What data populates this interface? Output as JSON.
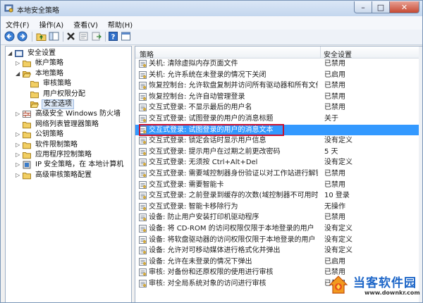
{
  "window": {
    "title": "本地安全策略"
  },
  "menu": [
    "文件(F)",
    "操作(A)",
    "查看(V)",
    "帮助(H)"
  ],
  "toolbar_icons": [
    "back-arrow-icon",
    "forward-arrow-icon",
    "up-folder-icon",
    "show-tree-icon",
    "delete-icon",
    "properties-icon",
    "export-icon",
    "help-icon",
    "console-icon"
  ],
  "tree": [
    {
      "label": "安全设置",
      "expander": "◢",
      "icon": "security-settings-icon",
      "indent": 0
    },
    {
      "label": "帐户策略",
      "expander": "▷",
      "icon": "folder-icon",
      "indent": 1
    },
    {
      "label": "本地策略",
      "expander": "◢",
      "icon": "folder-open-icon",
      "indent": 1
    },
    {
      "label": "审核策略",
      "expander": "",
      "icon": "folder-icon",
      "indent": 2
    },
    {
      "label": "用户权限分配",
      "expander": "",
      "icon": "folder-icon",
      "indent": 2
    },
    {
      "label": "安全选项",
      "expander": "",
      "icon": "folder-open-icon",
      "indent": 2,
      "selected": true
    },
    {
      "label": "高级安全 Windows 防火墙",
      "expander": "▷",
      "icon": "firewall-icon",
      "indent": 1
    },
    {
      "label": "网络列表管理器策略",
      "expander": "",
      "icon": "folder-icon",
      "indent": 1
    },
    {
      "label": "公钥策略",
      "expander": "▷",
      "icon": "folder-icon",
      "indent": 1
    },
    {
      "label": "软件限制策略",
      "expander": "▷",
      "icon": "folder-icon",
      "indent": 1
    },
    {
      "label": "应用程序控制策略",
      "expander": "▷",
      "icon": "folder-icon",
      "indent": 1
    },
    {
      "label": "IP 安全策略，在 本地计算机",
      "expander": "▷",
      "icon": "ip-security-icon",
      "indent": 1
    },
    {
      "label": "高级审核策略配置",
      "expander": "▷",
      "icon": "folder-icon",
      "indent": 1
    }
  ],
  "list": {
    "col_policy": "策略",
    "col_setting": "安全设置",
    "rows": [
      {
        "policy": "关机: 清除虚拟内存页面文件",
        "setting": "已禁用"
      },
      {
        "policy": "关机: 允许系统在未登录的情况下关闭",
        "setting": "已启用"
      },
      {
        "policy": "恢复控制台: 允许软盘复制并访问所有驱动器和所有文件夹",
        "setting": "已禁用"
      },
      {
        "policy": "恢复控制台: 允许自动管理登录",
        "setting": "已禁用"
      },
      {
        "policy": "交互式登录: 不显示最后的用户名",
        "setting": "已禁用"
      },
      {
        "policy": "交互式登录: 试图登录的用户的消息标题",
        "setting": "关于"
      },
      {
        "policy": "交互式登录: 试图登录的用户的消息文本",
        "setting": "",
        "selected": true
      },
      {
        "policy": "交互式登录: 锁定会话时显示用户信息",
        "setting": "没有定义"
      },
      {
        "policy": "交互式登录: 提示用户在过期之前更改密码",
        "setting": "5 天"
      },
      {
        "policy": "交互式登录: 无须按 Ctrl+Alt+Del",
        "setting": "没有定义"
      },
      {
        "policy": "交互式登录: 需要域控制器身份验证以对工作站进行解锁",
        "setting": "已禁用"
      },
      {
        "policy": "交互式登录: 需要智能卡",
        "setting": "已禁用"
      },
      {
        "policy": "交互式登录: 之前登录到缓存的次数(域控制器不可用时)",
        "setting": "10 登录"
      },
      {
        "policy": "交互式登录: 智能卡移除行为",
        "setting": "无操作"
      },
      {
        "policy": "设备: 防止用户安装打印机驱动程序",
        "setting": "已禁用"
      },
      {
        "policy": "设备: 将 CD-ROM 的访问权限仅限于本地登录的用户",
        "setting": "没有定义"
      },
      {
        "policy": "设备: 将软盘驱动器的访问权限仅限于本地登录的用户",
        "setting": "没有定义"
      },
      {
        "policy": "设备: 允许对可移动媒体进行格式化并弹出",
        "setting": "没有定义"
      },
      {
        "policy": "设备: 允许在未登录的情况下弹出",
        "setting": "已启用"
      },
      {
        "policy": "审核: 对备份和还原权限的使用进行审核",
        "setting": "已禁用"
      },
      {
        "policy": "审核: 对全局系统对象的访问进行审核",
        "setting": "已禁用"
      }
    ]
  },
  "watermark": {
    "brand": "当客软件园",
    "url": "www.downkr.com"
  },
  "colors": {
    "selection": "#3399ff",
    "highlight_box": "#c8102e",
    "brand_blue": "#1d66c8"
  }
}
